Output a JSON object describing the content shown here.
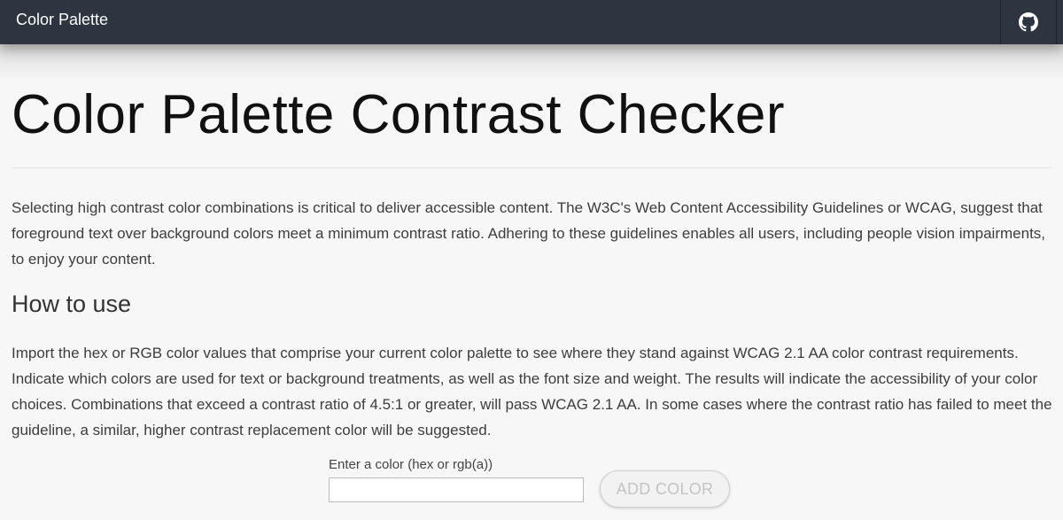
{
  "header": {
    "brand": "Color Palette",
    "github_icon": "github-icon",
    "background": "#2c3540"
  },
  "main": {
    "title": "Color Palette Contrast Checker",
    "intro": "Selecting high contrast color combinations is critical to deliver accessible content. The W3C's Web Content Accessibility Guidelines or WCAG, suggest that foreground text over background colors meet a minimum contrast ratio. Adhering to these guidelines enables all users, including people vision impairments, to enjoy your content.",
    "how_to_heading": "How to use",
    "how_to_text": "Import the hex or RGB color values that comprise your current color palette to see where they stand against WCAG 2.1 AA color contrast requirements. Indicate which colors are used for text or background treatments, as well as the font size and weight. The results will indicate the accessibility of your color choices. Combinations that exceed a contrast ratio of 4.5:1 or greater, will pass WCAG 2.1 AA. In some cases where the contrast ratio has failed to meet the guideline, a similar, higher contrast replacement color will be suggested."
  },
  "form": {
    "color_label": "Enter a color (hex or rgb(a))",
    "color_value": "",
    "add_button_label": "ADD COLOR"
  }
}
